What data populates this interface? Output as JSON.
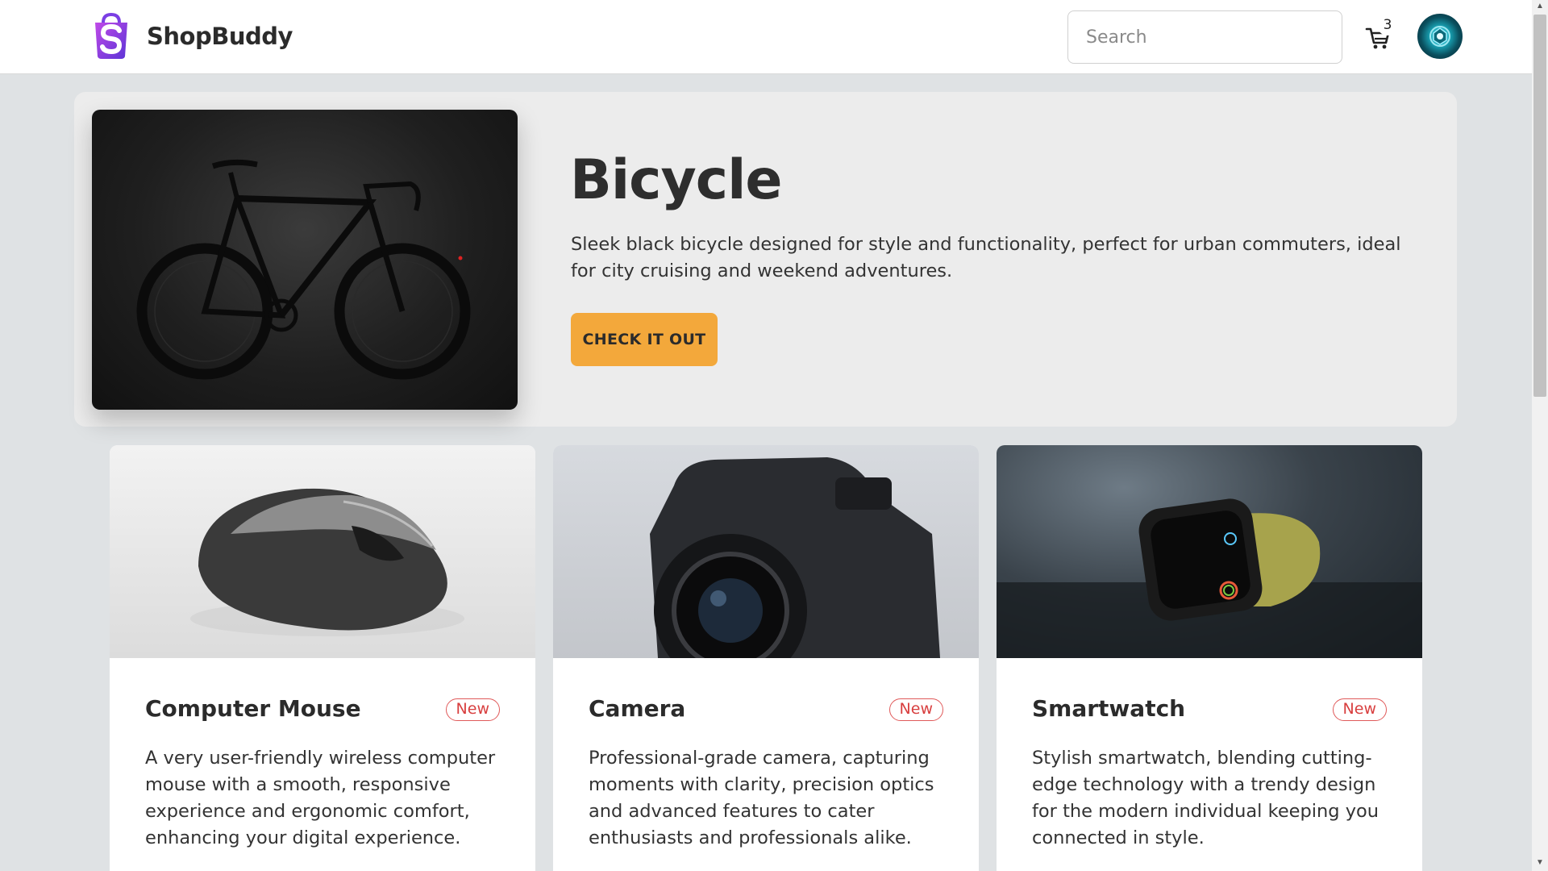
{
  "navbar": {
    "brand_name": "ShopBuddy",
    "search_placeholder": "Search",
    "cart_count": "3"
  },
  "hero": {
    "title": "Bicycle",
    "description": "Sleek black bicycle designed for style and functionality, perfect for urban commuters, ideal for city cruising and weekend adventures.",
    "cta_label": "CHECK IT OUT"
  },
  "products": [
    {
      "title": "Computer Mouse",
      "badge": "New",
      "description": "A very user-friendly wireless computer mouse with a smooth, responsive experience and ergonomic comfort, enhancing your digital experience."
    },
    {
      "title": "Camera",
      "badge": "New",
      "description": "Professional-grade camera, capturing moments with clarity, precision optics and advanced features to cater enthusiasts and professionals alike."
    },
    {
      "title": "Smartwatch",
      "badge": "New",
      "description": "Stylish smartwatch, blending cutting-edge technology with a trendy design for the modern individual keeping you connected in style."
    }
  ],
  "colors": {
    "accent": "#f3a83b",
    "badge": "#d83f3f",
    "brand": "#7b3fe4"
  },
  "icons": [
    "shopping-bag-logo-icon",
    "cart-icon",
    "avatar"
  ]
}
